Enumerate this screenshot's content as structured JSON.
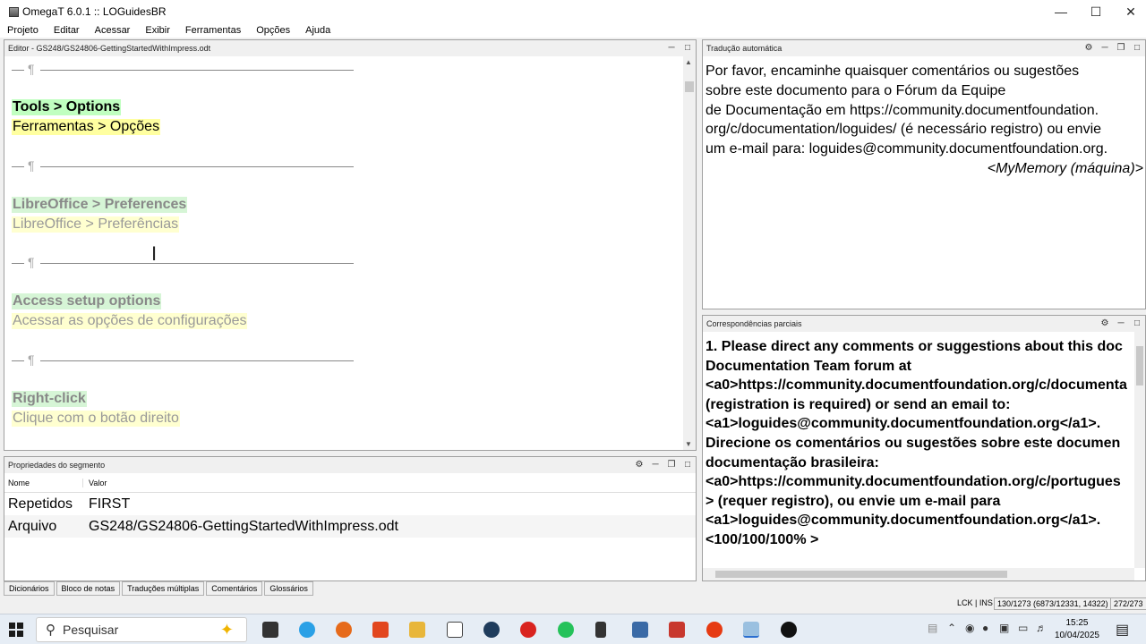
{
  "window": {
    "title": "OmegaT 6.0.1 :: LOGuidesBR"
  },
  "menu": [
    "Projeto",
    "Editar",
    "Acessar",
    "Exibir",
    "Ferramentas",
    "Opções",
    "Ajuda"
  ],
  "editor": {
    "title": "Editor - GS248/GS24806-GettingStartedWithImpress.odt",
    "pilcrow": "¶",
    "segments": [
      {
        "source": "Tools > Options",
        "target": "Ferramentas > Opções"
      },
      {
        "source": "LibreOffice > Preferences",
        "target": "LibreOffice > Preferências"
      },
      {
        "source": "Access setup options",
        "target": "Acessar as opções de configurações"
      },
      {
        "source": "Right-click",
        "target": "Clique com o botão direito"
      }
    ]
  },
  "machine_translation": {
    "title": "Tradução automática",
    "lines": [
      "Por favor, encaminhe quaisquer comentários ou sugestões",
      "sobre este documento para o Fórum da Equipe",
      "de Documentação em https://community.documentfoundation.",
      "org/c/documentation/loguides/ (é necessário registro) ou envie",
      "um e-mail para: loguides@community.documentfoundation.org."
    ],
    "origin": "<MyMemory (máquina)>"
  },
  "fuzzy_matches": {
    "title": "Correspondências parciais",
    "lines": [
      "1. Please direct any comments or suggestions about this doc",
      "Documentation Team forum at",
      "<a0>https://community.documentfoundation.org/c/documenta",
      "(registration is required) or send an email to:",
      "<a1>loguides@community.documentfoundation.org</a1>.",
      "Direcione os comentários ou sugestões sobre este documen",
      "documentação brasileira:",
      "<a0>https://community.documentfoundation.org/c/portugues",
      "> (requer registro), ou envie um e-mail para",
      "<a1>loguides@community.documentfoundation.org</a1>.",
      "<100/100/100% >"
    ]
  },
  "segment_properties": {
    "title": "Propriedades do segmento",
    "col_name": "Nome",
    "col_value": "Valor",
    "rows": [
      {
        "name": "Repetidos",
        "value": "FIRST"
      },
      {
        "name": "Arquivo",
        "value": "GS248/GS24806-GettingStartedWithImpress.odt"
      }
    ]
  },
  "bottom_tabs": [
    "Dicionários",
    "Bloco de notas",
    "Traduções múltiplas",
    "Comentários",
    "Glossários"
  ],
  "status": {
    "mode": "LCK | INS",
    "progress": "130/1273 (6873/12331, 14322)",
    "count": "272/273"
  },
  "taskbar": {
    "search_placeholder": "Pesquisar",
    "time": "15:25",
    "date": "10/04/2025"
  }
}
